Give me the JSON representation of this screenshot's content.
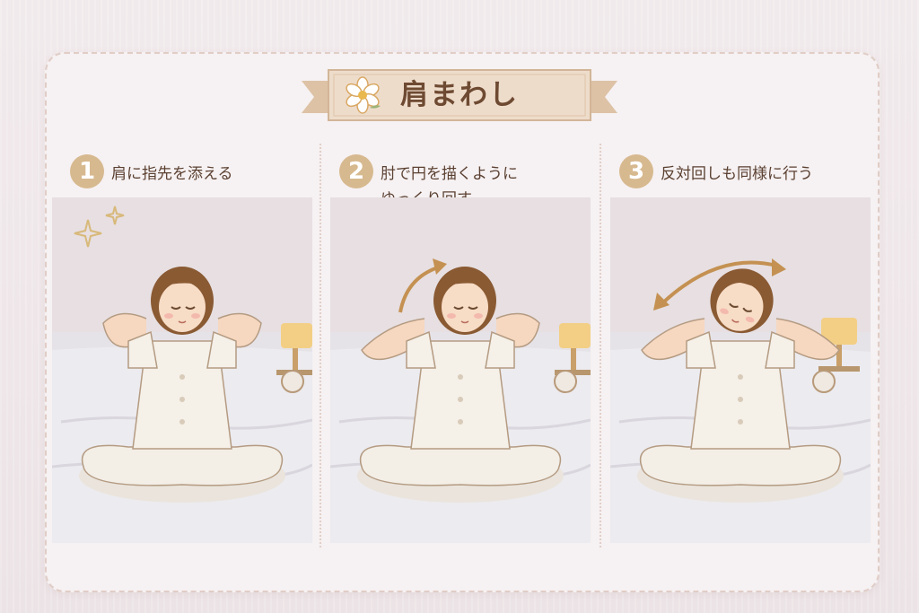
{
  "title": "肩まわし",
  "steps": [
    {
      "number": "1",
      "text": "肩に指先を添える"
    },
    {
      "number": "2",
      "text": "肘で円を描くように\nゆっくり回す"
    },
    {
      "number": "3",
      "text": "反対回しも同様に行う"
    }
  ],
  "icons": {
    "title": "flower-icon",
    "step1": "sparkle-icon",
    "step2": "curved-arrow-icon",
    "step3": "double-curved-arrow-icon"
  },
  "colors": {
    "badge": "#d7b98f",
    "text": "#5a4031",
    "title": "#6e4a32",
    "arrow": "#c49152"
  }
}
